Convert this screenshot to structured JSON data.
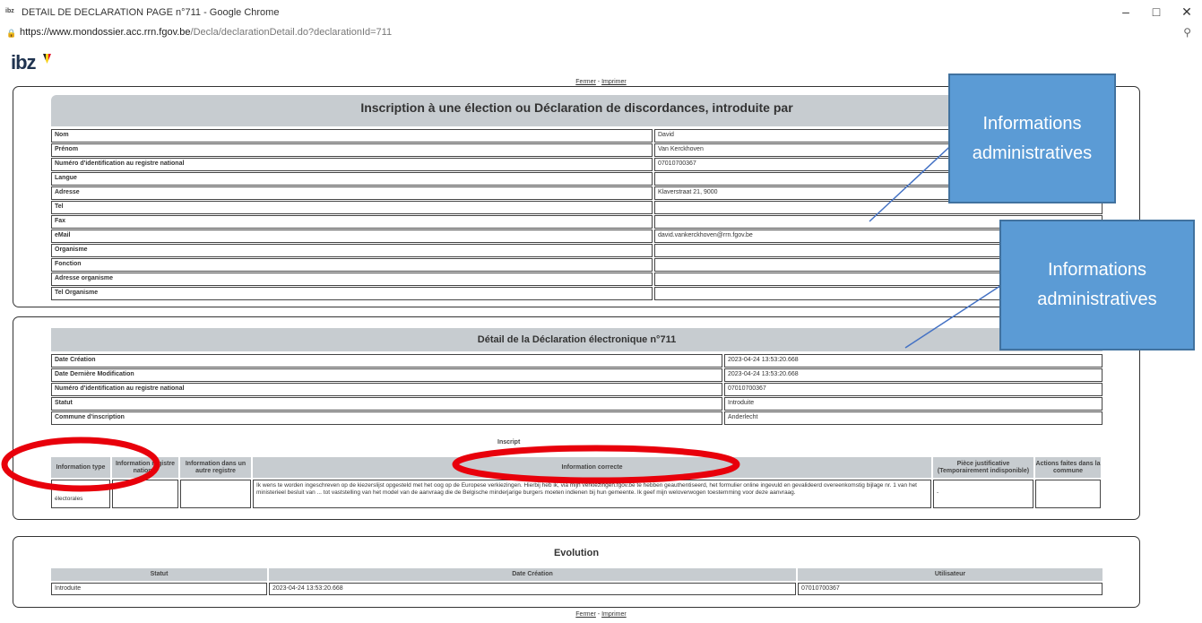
{
  "window": {
    "favicon": "ibz",
    "title": "DETAIL DE DECLARATION PAGE n°711 - Google Chrome",
    "controls": [
      "–",
      "□",
      "✕"
    ]
  },
  "address": {
    "host": "https://www.mondossier.acc.rrn.fgov.be",
    "path": "/Decla/declarationDetail.do?declarationId=711",
    "zoom_icon": "zoom-icon"
  },
  "logo": {
    "text": "ibz"
  },
  "links": {
    "close": "Fermer",
    "separator": " - ",
    "print": "Imprimer"
  },
  "inscription": {
    "title": "Inscription à une élection ou Déclaration de discordances, introduite par",
    "rows": [
      {
        "label": "Nom",
        "value": "David"
      },
      {
        "label": "Prénom",
        "value": "Van Kerckhoven"
      },
      {
        "label": "Numéro d'identification au registre national",
        "value": "07010700367"
      },
      {
        "label": "Langue",
        "value": ""
      },
      {
        "label": "Adresse",
        "value": "Klaverstraat 21, 9000"
      },
      {
        "label": "Tel",
        "value": ""
      },
      {
        "label": "Fax",
        "value": ""
      },
      {
        "label": "eMail",
        "value": "david.vankerckhoven@rrn.fgov.be"
      },
      {
        "label": "Organisme",
        "value": ""
      },
      {
        "label": "Fonction",
        "value": ""
      },
      {
        "label": "Adresse organisme",
        "value": ""
      },
      {
        "label": "Tel Organisme",
        "value": ""
      }
    ]
  },
  "detail": {
    "title": "Détail de la Déclaration électronique n°711",
    "rows": [
      {
        "label": "Date Création",
        "value": "2023-04-24 13:53:20.668"
      },
      {
        "label": "Date Dernière Modification",
        "value": "2023-04-24 13:53:20.668"
      },
      {
        "label": "Numéro d'identification au registre national",
        "value": "07010700367"
      },
      {
        "label": "Statut",
        "value": "Introduite"
      },
      {
        "label": "Commune d'inscription",
        "value": "Anderlecht"
      }
    ],
    "sub_caption": "Inscript",
    "table_headers": [
      "Information type",
      "Information registre national",
      "Information dans un autre registre",
      "Information correcte",
      "Pièce justificative (Temporairement indisponible)",
      "Actions faites dans la commune"
    ],
    "table_row": {
      "type": "électorales",
      "registre": "",
      "autre": "",
      "correcte": "Ik wens te worden ingeschreven op de kiezerslijst opgesteld met het oog op de Europese verkiezingen. Hierbij heb ik, via mijn verkiezingen.fgov.be te hebben geauthentiseerd, het formulier online ingevuld en gevalideerd overeenkomstig bijlage nr. 1 van het ministerieel besluit van ... tot vaststelling van het model van de aanvraag die de Belgische minderjarige burgers moeten indienen bij hun gemeente. Ik geef mijn weloverwogen toestemming voor deze aanvraag.",
      "piece": "-",
      "actions": ""
    }
  },
  "evolution": {
    "title": "Evolution",
    "headers": [
      "Statut",
      "Date Création",
      "Utilisateur"
    ],
    "row": [
      "Introduite",
      "2023-04-24 13:53:20.668",
      "07010700367"
    ]
  },
  "callouts": [
    {
      "line1": "Informations",
      "line2": "administratives"
    },
    {
      "line1": "Informations",
      "line2": "administratives"
    }
  ],
  "colors": {
    "callout": "#5b9bd5",
    "highlight": "#e8000b",
    "header_bg": "#c7ccd0"
  }
}
